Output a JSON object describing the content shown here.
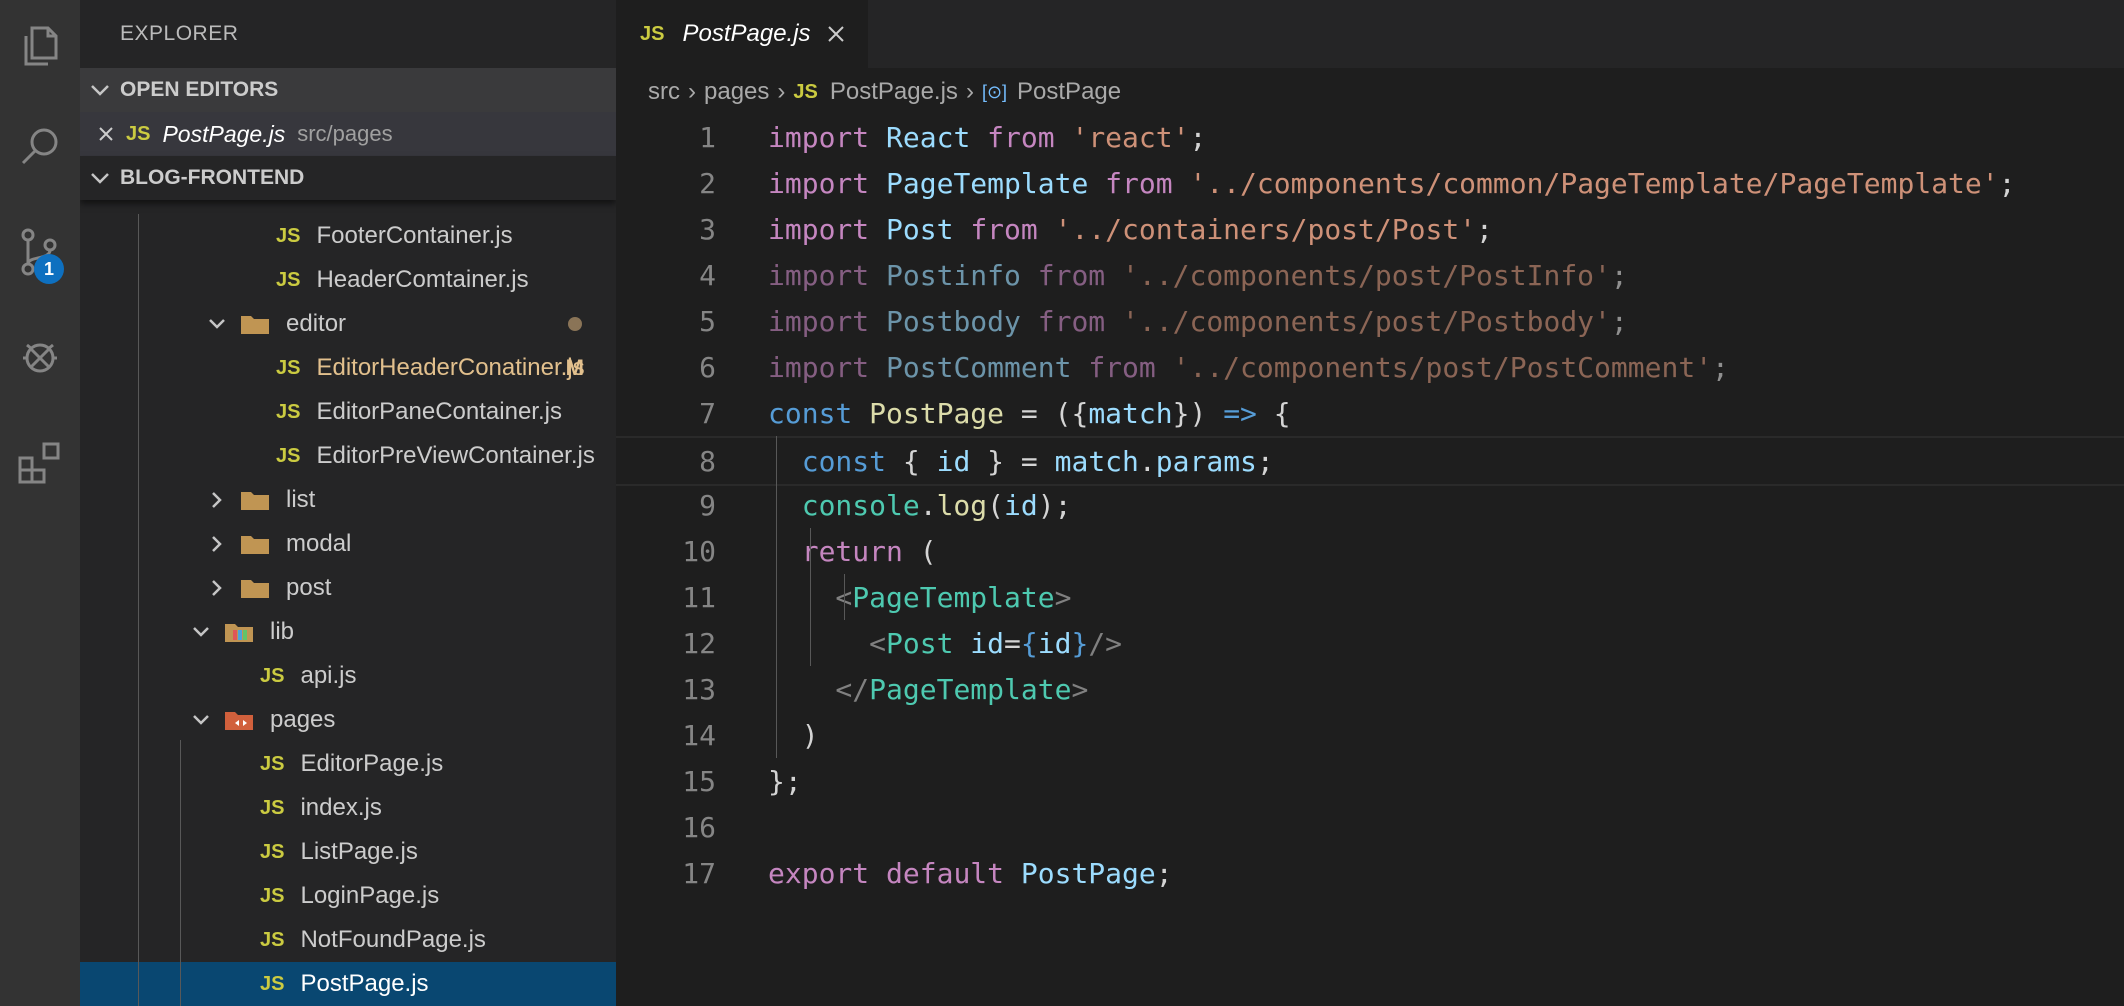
{
  "sidebar": {
    "title": "EXPLORER",
    "open_editors_label": "OPEN EDITORS",
    "open_editor": {
      "name": "PostPage.js",
      "path": "src/pages"
    },
    "project_label": "BLOG-FRONTEND",
    "tree": [
      {
        "label": "FooterContainer.js",
        "type": "file"
      },
      {
        "label": "HeaderComtainer.js",
        "type": "file"
      },
      {
        "label": "editor",
        "type": "folder-open"
      },
      {
        "label": "EditorHeaderConatiner.js",
        "type": "file",
        "badge": "M"
      },
      {
        "label": "EditorPaneContainer.js",
        "type": "file"
      },
      {
        "label": "EditorPreViewContainer.js",
        "type": "file"
      },
      {
        "label": "list",
        "type": "folder"
      },
      {
        "label": "modal",
        "type": "folder"
      },
      {
        "label": "post",
        "type": "folder"
      },
      {
        "label": "lib",
        "type": "folder-open"
      },
      {
        "label": "api.js",
        "type": "file"
      },
      {
        "label": "pages",
        "type": "folder-open"
      },
      {
        "label": "EditorPage.js",
        "type": "file"
      },
      {
        "label": "index.js",
        "type": "file"
      },
      {
        "label": "ListPage.js",
        "type": "file"
      },
      {
        "label": "LoginPage.js",
        "type": "file"
      },
      {
        "label": "NotFoundPage.js",
        "type": "file"
      },
      {
        "label": "PostPage.js",
        "type": "file",
        "selected": true
      }
    ],
    "js_icon_text": "JS"
  },
  "activity": {
    "scm_badge": "1",
    "icons": [
      "files-icon",
      "search-icon",
      "source-control-icon",
      "debug-icon",
      "extensions-icon"
    ]
  },
  "editor": {
    "tab_label": "PostPage.js",
    "breadcrumb": [
      "src",
      "pages",
      "PostPage.js",
      "PostPage"
    ],
    "line_numbers": [
      "1",
      "2",
      "3",
      "4",
      "5",
      "6",
      "7",
      "8",
      "9",
      "10",
      "11",
      "12",
      "13",
      "14",
      "15",
      "16",
      "17"
    ]
  },
  "code": {
    "l1": [
      "import",
      " React ",
      "from",
      " 'react'",
      ";"
    ],
    "l2": [
      "import",
      " PageTemplate ",
      "from",
      " '../components/common/PageTemplate/PageTemplate'",
      ";"
    ],
    "l3": [
      "import",
      " Post ",
      "from",
      " '../containers/post/Post'",
      ";"
    ],
    "l4": [
      "import",
      " Postinfo ",
      "from",
      " '../components/post/PostInfo'",
      ";"
    ],
    "l5": [
      "import",
      " Postbody ",
      "from",
      " '../components/post/Postbody'",
      ";"
    ],
    "l6": [
      "import",
      " PostComment ",
      "from",
      " '../components/post/PostComment'",
      ";"
    ],
    "l7": [
      "const",
      " PostPage",
      " = ({",
      "match",
      "}) ",
      "=>",
      " {"
    ],
    "l8": [
      "  const",
      " { ",
      "id",
      " } = ",
      "match",
      ".",
      "params",
      ";"
    ],
    "l9": [
      "  console",
      ".",
      "log",
      "(",
      "id",
      ");"
    ],
    "l10": [
      "  return",
      " ("
    ],
    "l11": [
      "    <",
      "PageTemplate",
      ">"
    ],
    "l12": [
      "      <",
      "Post",
      " id",
      "=",
      "{",
      "id",
      "}",
      "/>"
    ],
    "l13": [
      "    </",
      "PageTemplate",
      ">"
    ],
    "l14": [
      "  )"
    ],
    "l15": [
      "}",
      ";"
    ],
    "l17": [
      "export",
      " default",
      " PostPage",
      ";"
    ]
  }
}
